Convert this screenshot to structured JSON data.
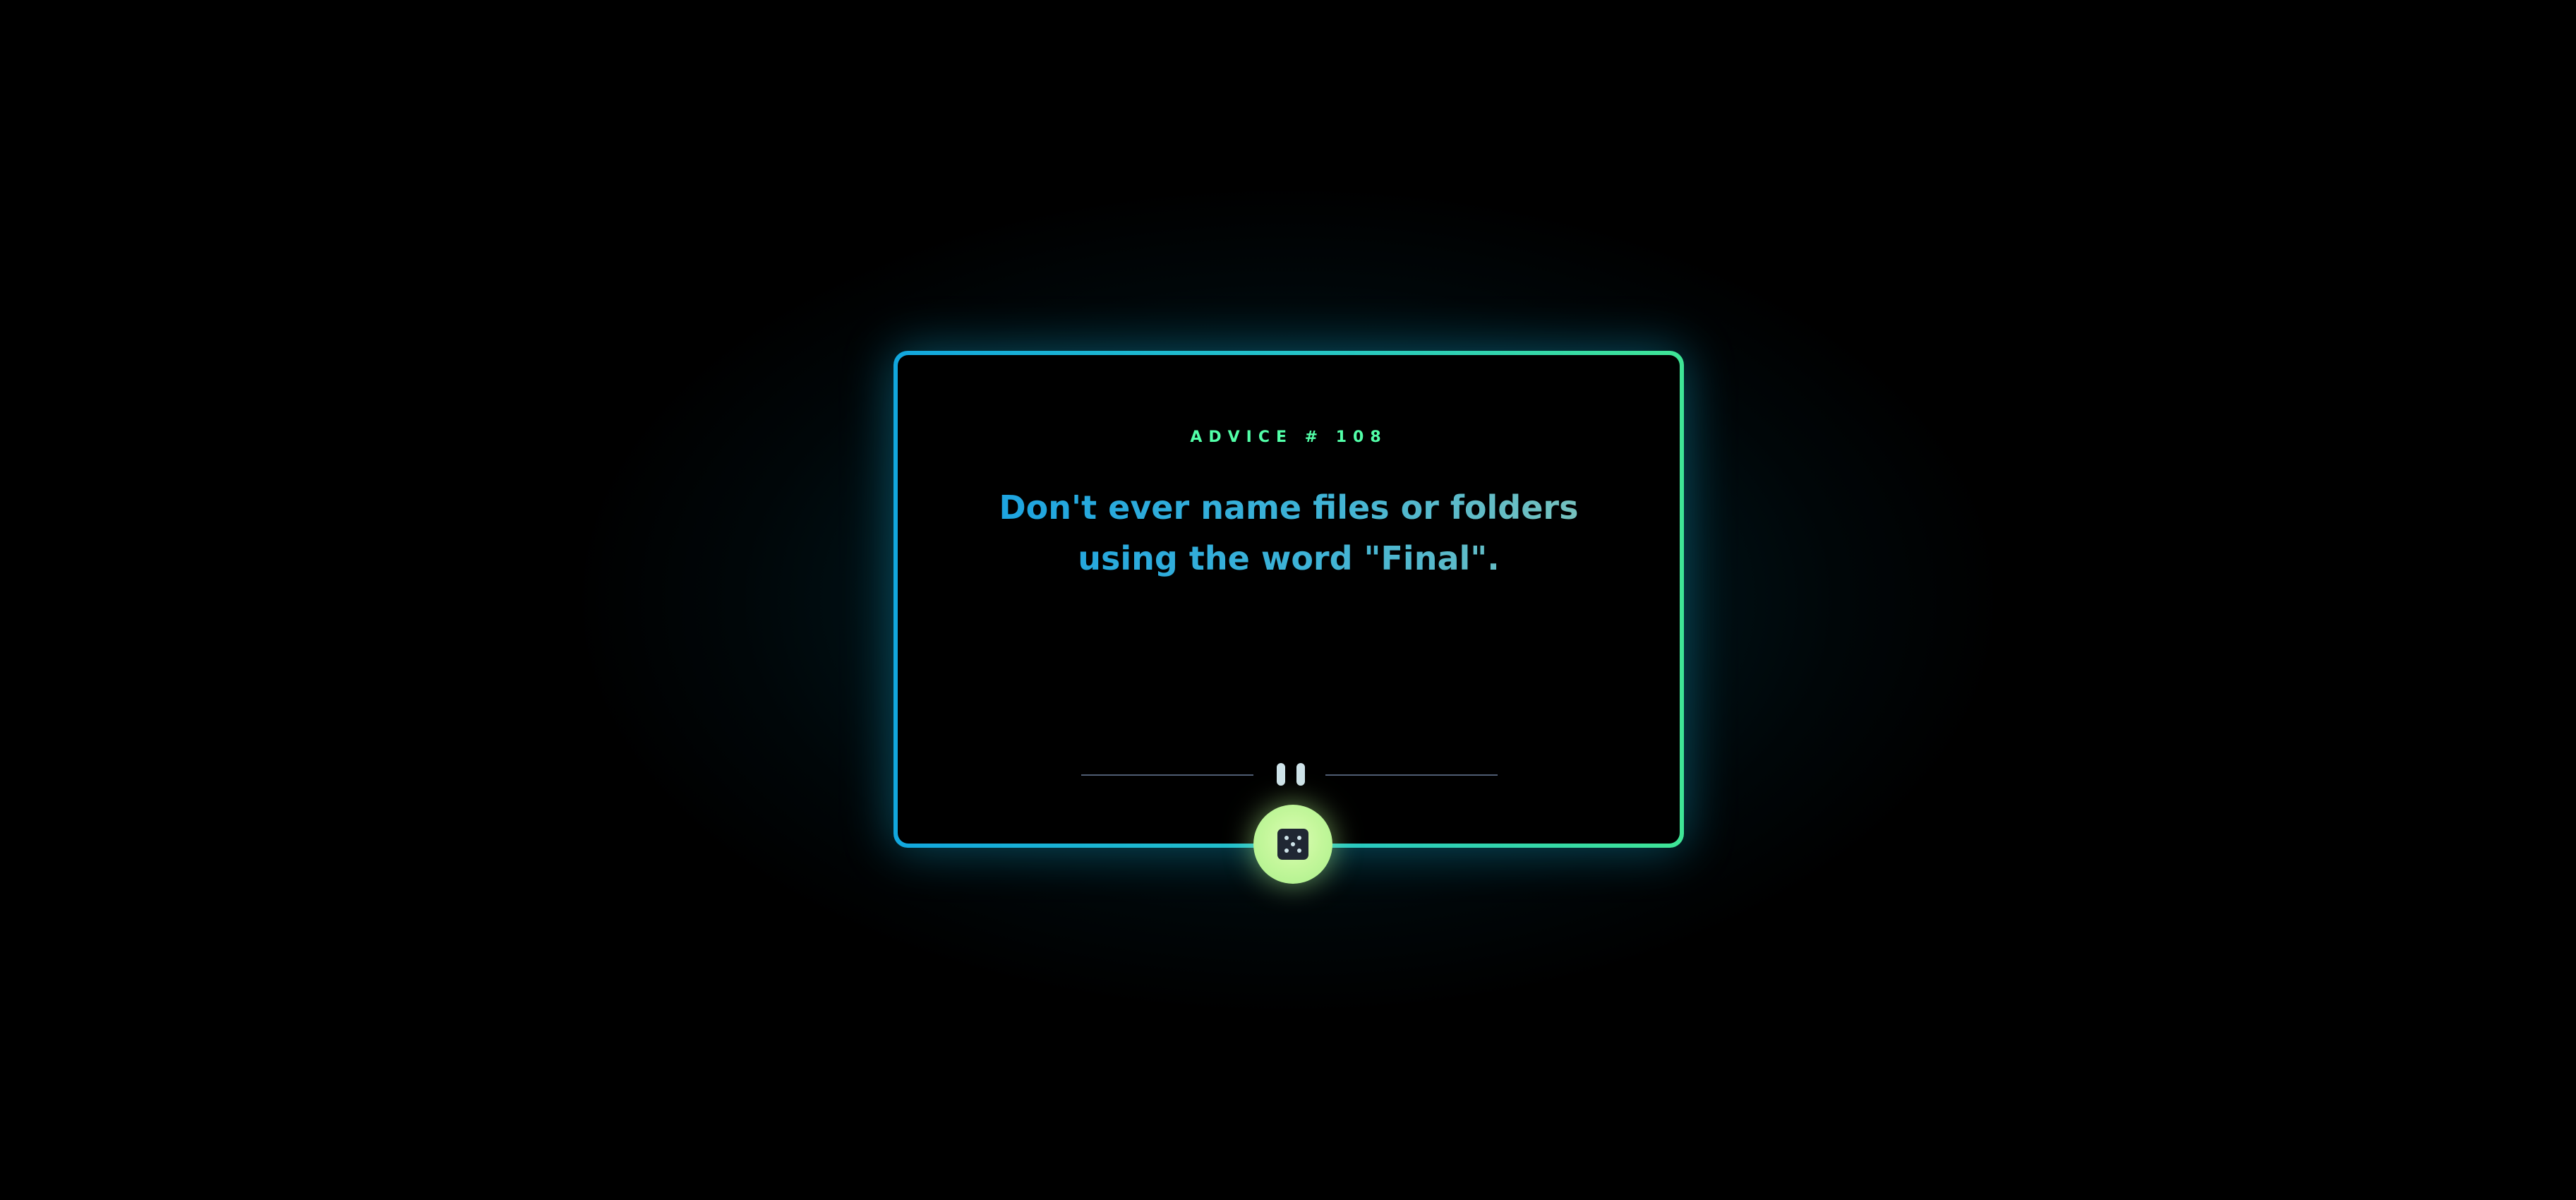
{
  "advice": {
    "id_label": "ADVICE # 108",
    "text": "Don't ever name files or folders using the word \"Final\"."
  },
  "icons": {
    "divider": "pause-icon",
    "generate": "dice-icon"
  },
  "colors": {
    "background": "#000000",
    "advice_id": "#52ffa8",
    "advice_text": "#1aa3e1",
    "border_start": "#12a7de",
    "border_end": "#3fe596",
    "button": "#c5f79c",
    "divider_line": "#4f5d73"
  }
}
